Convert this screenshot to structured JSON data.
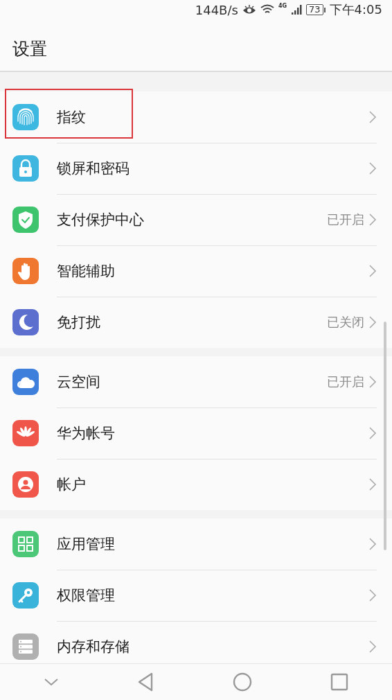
{
  "status_bar": {
    "speed": "144B/s",
    "network": "4G",
    "battery": "73",
    "time": "下午4:05"
  },
  "header": {
    "title": "设置"
  },
  "sections": [
    {
      "items": [
        {
          "label": "指纹",
          "kind": "fingerprint",
          "highlighted": true
        },
        {
          "label": "锁屏和密码",
          "kind": "lock",
          "highlighted": false
        },
        {
          "label": "支付保护中心",
          "value": "已开启",
          "kind": "shield",
          "highlighted": false
        },
        {
          "label": "智能辅助",
          "kind": "hand",
          "highlighted": false
        },
        {
          "label": "免打扰",
          "value": "已关闭",
          "kind": "moon",
          "highlighted": false
        }
      ]
    },
    {
      "items": [
        {
          "label": "云空间",
          "value": "已开启",
          "kind": "cloud",
          "highlighted": false
        },
        {
          "label": "华为帐号",
          "kind": "petals",
          "highlighted": false
        },
        {
          "label": "帐户",
          "kind": "person",
          "highlighted": false
        }
      ]
    },
    {
      "items": [
        {
          "label": "应用管理",
          "kind": "grid",
          "highlighted": false
        },
        {
          "label": "权限管理",
          "kind": "key",
          "highlighted": false
        },
        {
          "label": "内存和存储",
          "kind": "storage",
          "highlighted": false
        }
      ]
    }
  ]
}
